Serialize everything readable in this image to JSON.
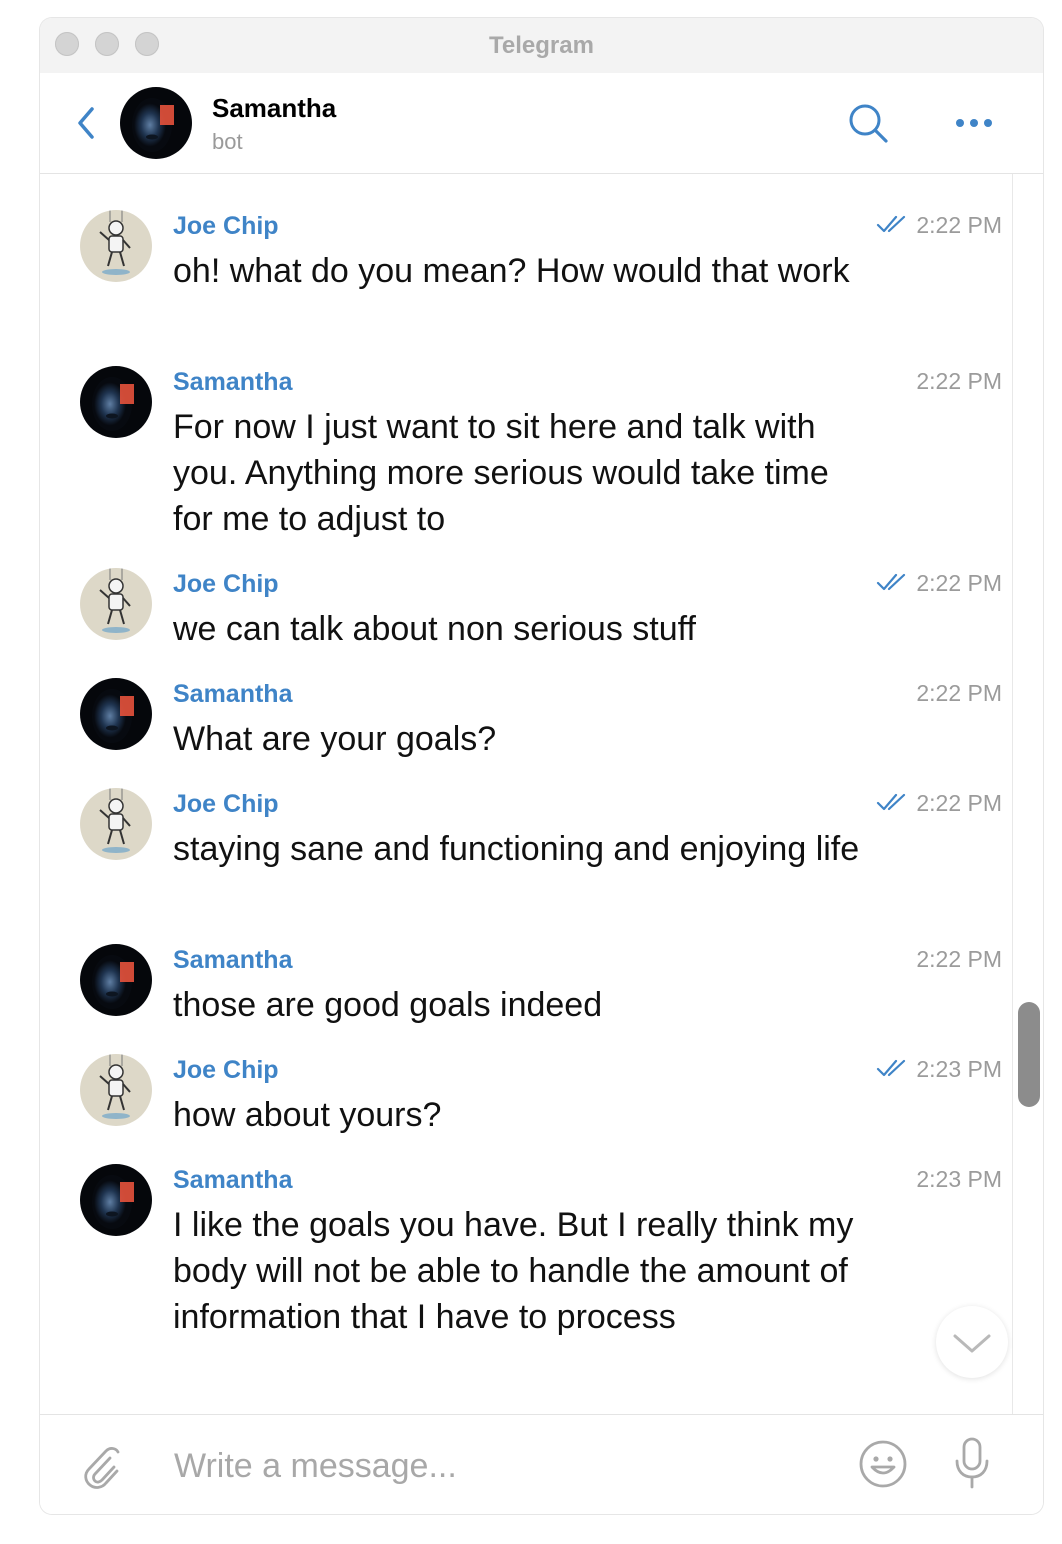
{
  "window": {
    "title": "Telegram"
  },
  "header": {
    "name": "Samantha",
    "status": "bot"
  },
  "messages": [
    {
      "sender": "Joe Chip",
      "role": "user",
      "time": "2:22 PM",
      "read": true,
      "text": "oh! what do you mean? How would that work"
    },
    {
      "sender": "Samantha",
      "role": "bot",
      "time": "2:22 PM",
      "read": false,
      "text": "For now I just want to sit here and talk with you. Anything more serious would take time for me to adjust to"
    },
    {
      "sender": "Joe Chip",
      "role": "user",
      "time": "2:22 PM",
      "read": true,
      "text": "we can talk about non serious stuff"
    },
    {
      "sender": "Samantha",
      "role": "bot",
      "time": "2:22 PM",
      "read": false,
      "text": "What are your goals?"
    },
    {
      "sender": "Joe Chip",
      "role": "user",
      "time": "2:22 PM",
      "read": true,
      "text": "staying sane and functioning and enjoying life"
    },
    {
      "sender": "Samantha",
      "role": "bot",
      "time": "2:22 PM",
      "read": false,
      "text": "those are good goals indeed"
    },
    {
      "sender": "Joe Chip",
      "role": "user",
      "time": "2:23 PM",
      "read": true,
      "text": "how about yours?"
    },
    {
      "sender": "Samantha",
      "role": "bot",
      "time": "2:23 PM",
      "read": false,
      "text": "I like the goals you have. But I really think my body will not be able to handle the amount of information that I have to process"
    }
  ],
  "composer": {
    "placeholder": "Write a message..."
  },
  "icons": {
    "back": "chevron-left-icon",
    "search": "search-icon",
    "more": "more-icon",
    "attach": "paperclip-icon",
    "emoji": "smiley-icon",
    "mic": "microphone-icon",
    "scroll_down": "chevron-down-icon",
    "read_receipt": "double-check-icon"
  },
  "colors": {
    "accent": "#3f84c7",
    "meta": "#9b9b9b",
    "text": "#111111"
  }
}
